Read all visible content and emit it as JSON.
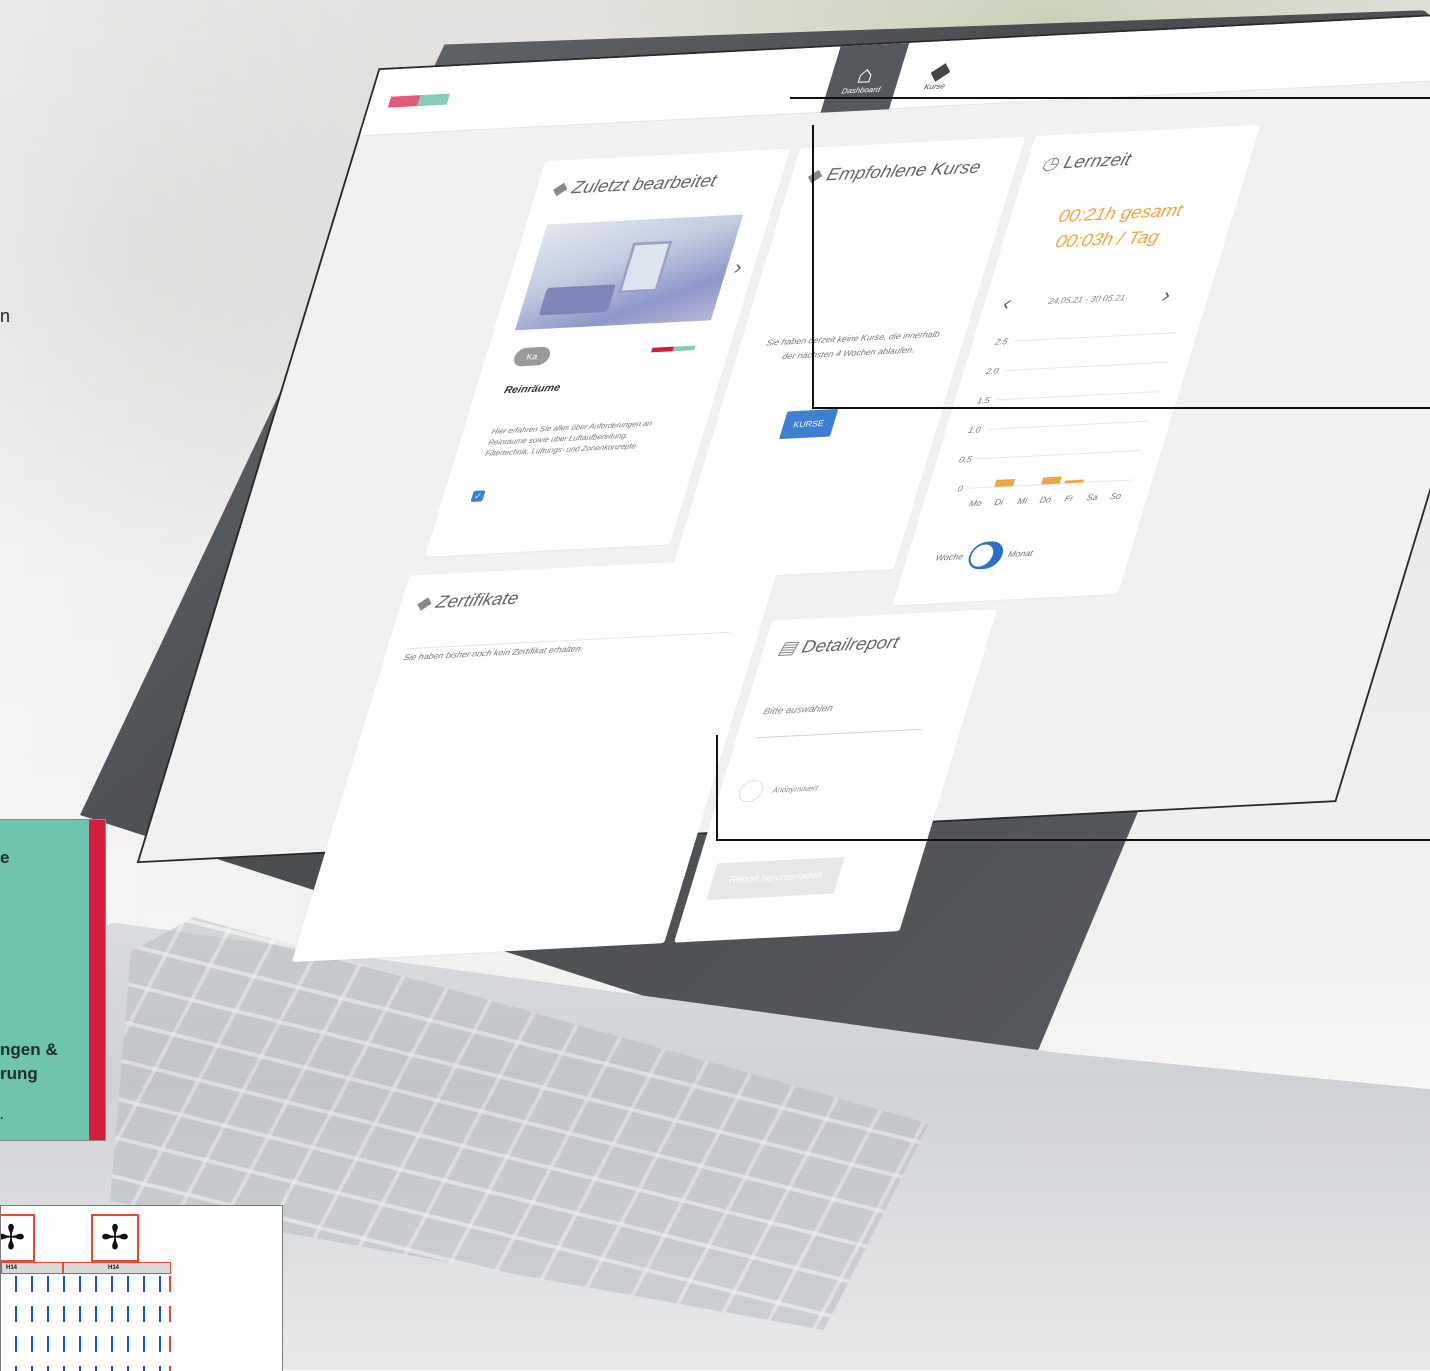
{
  "nav": {
    "dashboard_label": "Dashboard",
    "courses_label": "Kurse",
    "home_icon": "home-icon",
    "courses_icon": "layers-icon",
    "menu_icon": "hamburger-menu-icon"
  },
  "brand_colors": [
    "#e35b78",
    "#86cdb6"
  ],
  "recent": {
    "title": "Zuletzt bearbeitet",
    "badge": "Ka",
    "course_title": "Reinräume",
    "description": "Hier erfahren Sie alles über Anforderungen an Reinräume sowie über Luftaufbereitung, Filtertechnik, Lüftungs- und Zonenkonzepte.",
    "checkbox": "✓"
  },
  "recommended": {
    "title": "Empfohlene Kurse",
    "empty_text": "Sie haben derzeit keine Kurse, die innerhalb der nächsten 4 Wochen ablaufen.",
    "button": "KURSE"
  },
  "learning_time": {
    "title": "Lernzeit",
    "total": "00:21h gesamt",
    "per_day": "00:03h / Tag",
    "date_range": "24.05.21 - 30.05.21",
    "toggle_left": "Woche",
    "toggle_right": "Monat",
    "accent": "#f0a640"
  },
  "chart_data": {
    "type": "bar",
    "categories": [
      "Mo",
      "Di",
      "Mi",
      "Do",
      "Fr",
      "Sa",
      "So"
    ],
    "values": [
      0,
      0.12,
      0,
      0.12,
      0.05,
      0,
      0
    ],
    "y_ticks": [
      "0",
      "0.5",
      "1.0",
      "1.5",
      "2.0",
      "2.5"
    ],
    "ylim": [
      0,
      2.5
    ],
    "grid": true,
    "bar_color": "#f0a640"
  },
  "certificates": {
    "title": "Zertifikate",
    "empty_text": "Sie haben bisher noch kein Zertifikat erhalten."
  },
  "report": {
    "title": "Detailreport",
    "select_placeholder": "Bitte auswählen",
    "radio_label": "Anonymisiert",
    "button": "Report herunterladen"
  },
  "overlays": {
    "fragment_n": "n",
    "box_lines": [
      "e",
      "ngen &",
      "rung",
      "."
    ],
    "filter_labels": [
      "H14",
      "H14"
    ]
  }
}
